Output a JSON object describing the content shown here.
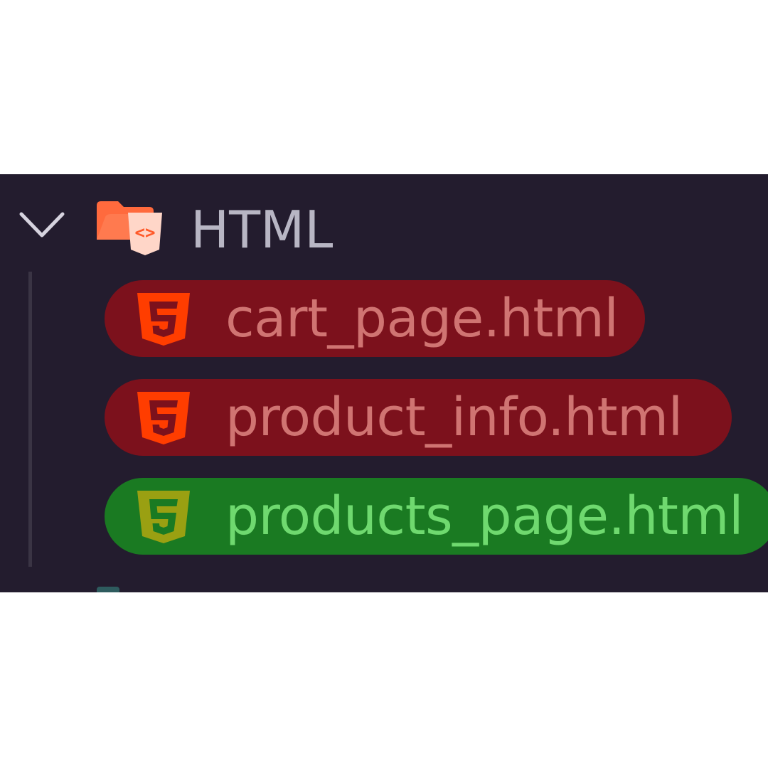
{
  "explorer": {
    "folder": {
      "label": "HTML",
      "expanded": true,
      "icon": "html-folder-open-icon",
      "chevron_icon": "chevron-down-icon"
    },
    "files": [
      {
        "name": "cart_page.html",
        "icon": "html5-icon",
        "highlight": "red"
      },
      {
        "name": "product_info.html",
        "icon": "html5-icon",
        "highlight": "red"
      },
      {
        "name": "products_page.html",
        "icon": "html5-icon",
        "highlight": "green"
      }
    ]
  },
  "colors": {
    "panel_background": "#231c2e",
    "red_highlight": "#7c111c",
    "red_text": "#d07472",
    "green_highlight": "#1a7a22",
    "green_text": "#6fd96f",
    "html5_orange": "#ff3d00",
    "html5_olive": "#9aa012",
    "folder_orange": "#ff6a3d"
  }
}
